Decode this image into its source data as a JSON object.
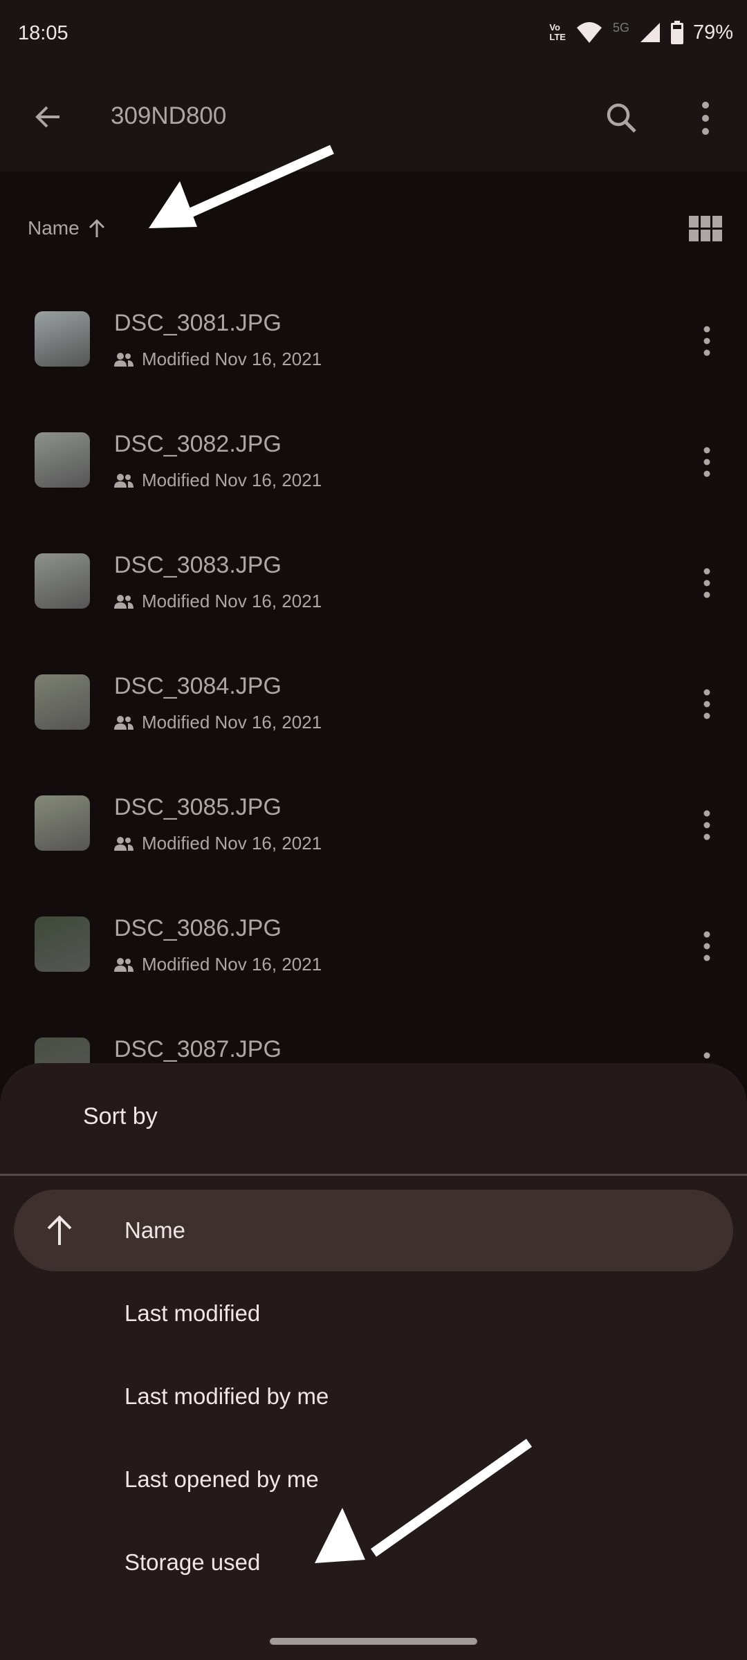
{
  "status_bar": {
    "time": "18:05",
    "volte": "Vo LTE",
    "network": "5G",
    "battery": "79%",
    "icons": [
      "volte-icon",
      "wifi-icon",
      "5g-icon",
      "signal-icon",
      "battery-icon"
    ]
  },
  "app_bar": {
    "title": "309ND800",
    "back_icon": "arrow-left-icon",
    "search_icon": "search-icon",
    "more_icon": "more-vert-icon"
  },
  "sort_bar": {
    "label": "Name",
    "direction_icon": "arrow-up-icon",
    "view_toggle_icon": "grid-view-icon"
  },
  "files": [
    {
      "name": "DSC_3081.JPG",
      "meta": "Modified Nov 16, 2021",
      "thumb_color": "#9aa0a0"
    },
    {
      "name": "DSC_3082.JPG",
      "meta": "Modified Nov 16, 2021",
      "thumb_color": "#8d918d"
    },
    {
      "name": "DSC_3083.JPG",
      "meta": "Modified Nov 16, 2021",
      "thumb_color": "#8e918c"
    },
    {
      "name": "DSC_3084.JPG",
      "meta": "Modified Nov 16, 2021",
      "thumb_color": "#7c8070"
    },
    {
      "name": "DSC_3085.JPG",
      "meta": "Modified Nov 16, 2021",
      "thumb_color": "#868a78"
    },
    {
      "name": "DSC_3086.JPG",
      "meta": "Modified Nov 16, 2021",
      "thumb_color": "#3f4a39"
    },
    {
      "name": "DSC_3087.JPG",
      "meta": "",
      "thumb_color": "#4a5044"
    }
  ],
  "sort_sheet": {
    "title": "Sort by",
    "options": [
      {
        "label": "Name",
        "selected": true,
        "icon": "arrow-up-icon"
      },
      {
        "label": "Last modified",
        "selected": false
      },
      {
        "label": "Last modified by me",
        "selected": false
      },
      {
        "label": "Last opened by me",
        "selected": false
      },
      {
        "label": "Storage used",
        "selected": false
      }
    ]
  },
  "colors": {
    "background": "#120c0c",
    "sheet": "#231a19",
    "selected_option": "#3d302f",
    "text_primary": "#efe7e6",
    "text_secondary": "#ada6a5"
  }
}
